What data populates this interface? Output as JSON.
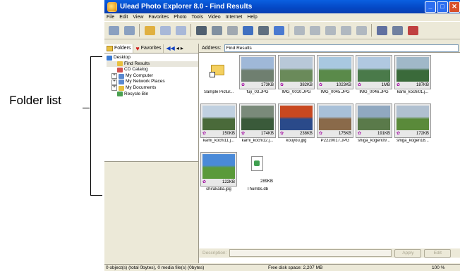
{
  "callout": {
    "label": "Folder list"
  },
  "window": {
    "title": "Ulead Photo Explorer 8.0 - Find Results",
    "controls": {
      "minimize": "_",
      "maximize": "□",
      "close": "✕"
    }
  },
  "menu": [
    "File",
    "Edit",
    "View",
    "Favorites",
    "Photo",
    "Tools",
    "Video",
    "Internet",
    "Help"
  ],
  "toolbar": [
    "grid-view-icon",
    "copy-view-icon",
    "open-folder-icon",
    "back-arrow-icon",
    "forward-arrow-icon",
    "camera-icon",
    "scanner-icon",
    "stamp-icon",
    "photo-editor-icon",
    "capture-icon",
    "thumbnail-view-icon",
    "grayscale-icon",
    "enhance-icon",
    "rotate-ccw-icon",
    "rotate-cw-icon",
    "tool-icon",
    "printer-icon",
    "print-preview-icon",
    "monitor-icon"
  ],
  "left_panel": {
    "tabs": [
      "Folders",
      "Favorites"
    ],
    "tree": [
      {
        "label": "Desktop",
        "level": 0,
        "expander": "",
        "icon_color": "#3a7bd5"
      },
      {
        "label": "Find Results",
        "level": 1,
        "expander": "",
        "icon_color": "#e8c040",
        "selected": true
      },
      {
        "label": "CD Catalog",
        "level": 1,
        "expander": "",
        "icon_color": "#d05050"
      },
      {
        "label": "My Computer",
        "level": 1,
        "expander": "+",
        "icon_color": "#5a8ad0"
      },
      {
        "label": "My Network Places",
        "level": 1,
        "expander": "+",
        "icon_color": "#5a8ad0"
      },
      {
        "label": "My Documents",
        "level": 1,
        "expander": "+",
        "icon_color": "#e8c040"
      },
      {
        "label": "Recycle Bin",
        "level": 1,
        "expander": "",
        "icon_color": "#4aa050"
      }
    ]
  },
  "address": {
    "label": "Address:",
    "value": "Find Results"
  },
  "thumbnails": [
    {
      "name": "Sample Pictur...",
      "size": "",
      "kind": "folder"
    },
    {
      "name": "fuji_03.JPG",
      "size": "173KB",
      "kind": "photo",
      "colors": [
        "#9fb8d8",
        "#6f7f70"
      ]
    },
    {
      "name": "IMG_0010.JPG",
      "size": "382KB",
      "kind": "photo",
      "colors": [
        "#b8c8d8",
        "#6a8a5a"
      ]
    },
    {
      "name": "IMG_0045.JPG",
      "size": "1023KB",
      "kind": "photo",
      "colors": [
        "#a8c8e0",
        "#5a8a4a"
      ]
    },
    {
      "name": "IMG_0046.JPG",
      "size": "1MB",
      "kind": "photo",
      "colors": [
        "#b0c8e0",
        "#4a7a4a"
      ]
    },
    {
      "name": "kami_kochi01.j...",
      "size": "187KB",
      "kind": "photo",
      "colors": [
        "#a0b8c8",
        "#3a6a3a"
      ]
    },
    {
      "name": "kami_kochi11.j...",
      "size": "150KB",
      "kind": "photo",
      "colors": [
        "#c0d0e0",
        "#4a6a3a"
      ]
    },
    {
      "name": "kami_kochi12.j...",
      "size": "174KB",
      "kind": "photo",
      "colors": [
        "#7a8a7a",
        "#3a5a3a"
      ]
    },
    {
      "name": "kouyou.jpg",
      "size": "238KB",
      "kind": "photo",
      "colors": [
        "#c84820",
        "#2a4a8a"
      ]
    },
    {
      "name": "P2220017.JPG",
      "size": "175KB",
      "kind": "photo",
      "colors": [
        "#a8c0d8",
        "#8a6a4a"
      ]
    },
    {
      "name": "shiga_kogen09...",
      "size": "191KB",
      "kind": "photo",
      "colors": [
        "#90a8c0",
        "#5a7a4a"
      ]
    },
    {
      "name": "shiga_kogen18...",
      "size": "172KB",
      "kind": "photo",
      "colors": [
        "#b0c0d0",
        "#5a8a3a"
      ]
    },
    {
      "name": "shirakaba.jpg",
      "size": "122KB",
      "kind": "photo",
      "colors": [
        "#4a8ad8",
        "#5a9a3a"
      ]
    },
    {
      "name": "Thumbs.db",
      "size": "289KB",
      "kind": "file"
    }
  ],
  "description": {
    "label": "Description:",
    "apply": "Apply",
    "edit": "Edit"
  },
  "status": {
    "objects": "0 object(s) (total 0bytes), 0 media file(s) (0bytes)",
    "disk": "Free disk space: 2,207 MB",
    "zoom": "100 %"
  }
}
